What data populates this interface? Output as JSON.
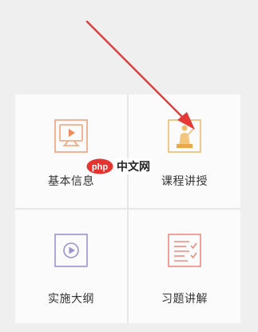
{
  "colors": {
    "background": "#efefef",
    "tile": "#fbfbfb",
    "orange": "#f0a27b",
    "gold": "#efbc6c",
    "purple": "#9a93cf",
    "red": "#ec8c82",
    "arrow": "#e53935",
    "watermark_red": "#e5332f"
  },
  "menu": [
    {
      "label": "基本信息",
      "icon": "tv-video-icon"
    },
    {
      "label": "课程讲授",
      "icon": "teacher-podium-icon"
    },
    {
      "label": "实施大纲",
      "icon": "play-box-icon"
    },
    {
      "label": "习题讲解",
      "icon": "checklist-icon"
    }
  ],
  "watermark": {
    "logo_text": "php",
    "text": "中文网"
  }
}
